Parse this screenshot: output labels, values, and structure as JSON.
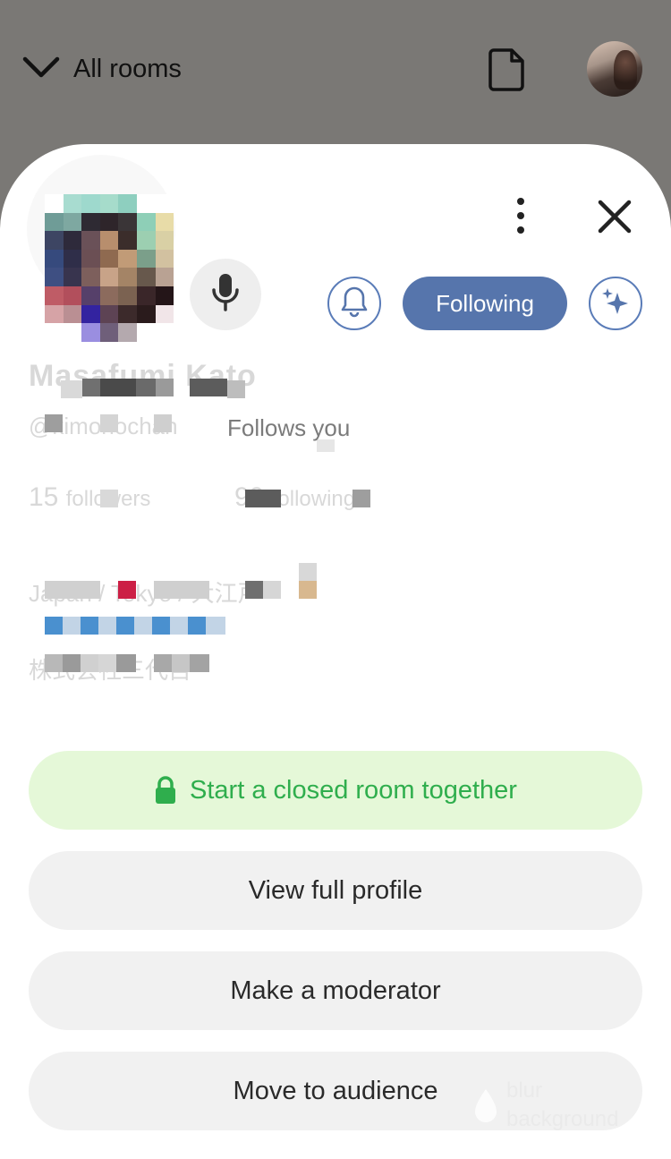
{
  "topbar": {
    "title": "All rooms",
    "icons": [
      "chevron-down-icon",
      "document-icon",
      "profile-avatar"
    ]
  },
  "profile": {
    "name": "Masafumi Kato",
    "handle": "@kimonochan",
    "follows_you": "Follows you",
    "followers_count": "15",
    "followers_label": "followers",
    "following_count": "99",
    "following_label": "following",
    "bio_line1": "Japan / Tokyo / 大江戸",
    "bio_line3": "株式会社三代目"
  },
  "actions": {
    "following_label": "Following",
    "closed_room": "Start a closed room together",
    "full_profile": "View full profile",
    "make_moderator": "Make a moderator",
    "move_audience": "Move to audience"
  },
  "watermark": {
    "line1": "blur",
    "line2": "background"
  },
  "colors": {
    "accent_blue": "#5675ac",
    "green_text": "#2fae4d",
    "green_bg": "#e5f8d8",
    "overlay": "#7a7875"
  }
}
